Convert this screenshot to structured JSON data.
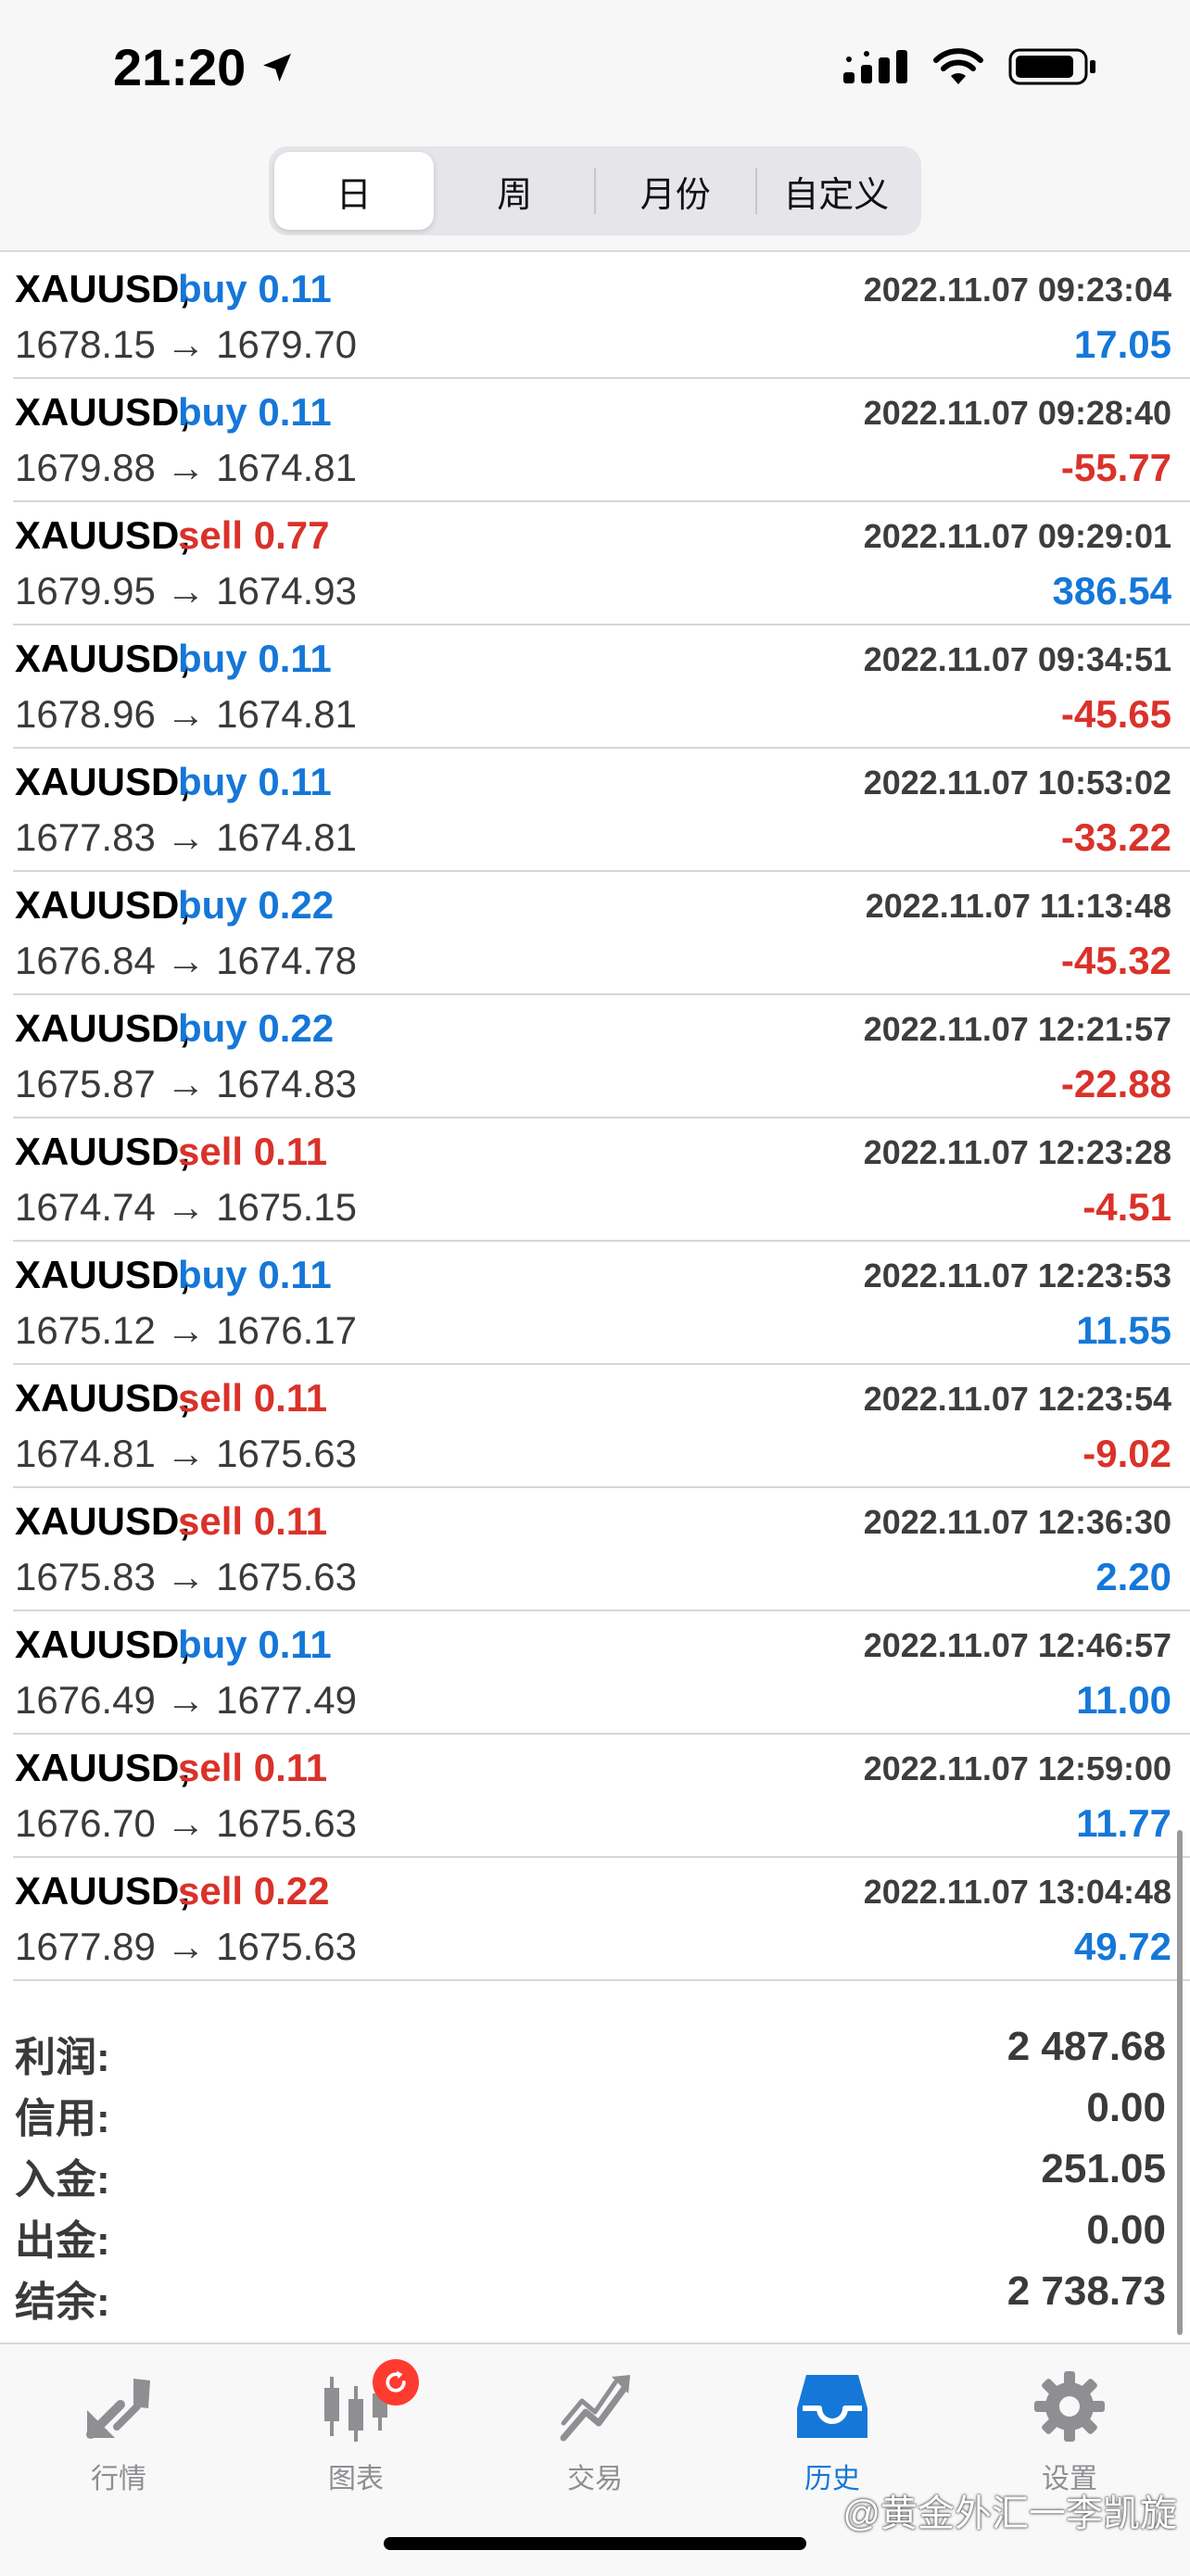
{
  "status_bar": {
    "time": "21:20"
  },
  "period_tabs": [
    {
      "label": "日",
      "active": true
    },
    {
      "label": "周",
      "active": false
    },
    {
      "label": "月份",
      "active": false
    },
    {
      "label": "自定义",
      "active": false
    }
  ],
  "deals": [
    {
      "symbol": "XAUUSD,",
      "type": "buy 0.11",
      "side": "buy",
      "prices": "1678.15 → 1679.70",
      "time": "2022.11.07 09:23:04",
      "profit": "17.05",
      "profit_sign": "pos"
    },
    {
      "symbol": "XAUUSD,",
      "type": "buy 0.11",
      "side": "buy",
      "prices": "1679.88 → 1674.81",
      "time": "2022.11.07 09:28:40",
      "profit": "-55.77",
      "profit_sign": "neg"
    },
    {
      "symbol": "XAUUSD,",
      "type": "sell 0.77",
      "side": "sell",
      "prices": "1679.95 → 1674.93",
      "time": "2022.11.07 09:29:01",
      "profit": "386.54",
      "profit_sign": "pos"
    },
    {
      "symbol": "XAUUSD,",
      "type": "buy 0.11",
      "side": "buy",
      "prices": "1678.96 → 1674.81",
      "time": "2022.11.07 09:34:51",
      "profit": "-45.65",
      "profit_sign": "neg"
    },
    {
      "symbol": "XAUUSD,",
      "type": "buy 0.11",
      "side": "buy",
      "prices": "1677.83 → 1674.81",
      "time": "2022.11.07 10:53:02",
      "profit": "-33.22",
      "profit_sign": "neg"
    },
    {
      "symbol": "XAUUSD,",
      "type": "buy 0.22",
      "side": "buy",
      "prices": "1676.84 → 1674.78",
      "time": "2022.11.07 11:13:48",
      "profit": "-45.32",
      "profit_sign": "neg"
    },
    {
      "symbol": "XAUUSD,",
      "type": "buy 0.22",
      "side": "buy",
      "prices": "1675.87 → 1674.83",
      "time": "2022.11.07 12:21:57",
      "profit": "-22.88",
      "profit_sign": "neg"
    },
    {
      "symbol": "XAUUSD,",
      "type": "sell 0.11",
      "side": "sell",
      "prices": "1674.74 → 1675.15",
      "time": "2022.11.07 12:23:28",
      "profit": "-4.51",
      "profit_sign": "neg"
    },
    {
      "symbol": "XAUUSD,",
      "type": "buy 0.11",
      "side": "buy",
      "prices": "1675.12 → 1676.17",
      "time": "2022.11.07 12:23:53",
      "profit": "11.55",
      "profit_sign": "pos"
    },
    {
      "symbol": "XAUUSD,",
      "type": "sell 0.11",
      "side": "sell",
      "prices": "1674.81 → 1675.63",
      "time": "2022.11.07 12:23:54",
      "profit": "-9.02",
      "profit_sign": "neg"
    },
    {
      "symbol": "XAUUSD,",
      "type": "sell 0.11",
      "side": "sell",
      "prices": "1675.83 → 1675.63",
      "time": "2022.11.07 12:36:30",
      "profit": "2.20",
      "profit_sign": "pos"
    },
    {
      "symbol": "XAUUSD,",
      "type": "buy 0.11",
      "side": "buy",
      "prices": "1676.49 → 1677.49",
      "time": "2022.11.07 12:46:57",
      "profit": "11.00",
      "profit_sign": "pos"
    },
    {
      "symbol": "XAUUSD,",
      "type": "sell 0.11",
      "side": "sell",
      "prices": "1676.70 → 1675.63",
      "time": "2022.11.07 12:59:00",
      "profit": "11.77",
      "profit_sign": "pos"
    },
    {
      "symbol": "XAUUSD,",
      "type": "sell 0.22",
      "side": "sell",
      "prices": "1677.89 → 1675.63",
      "time": "2022.11.07 13:04:48",
      "profit": "49.72",
      "profit_sign": "pos"
    }
  ],
  "summary": [
    {
      "label": "利润:",
      "value": "2 487.68"
    },
    {
      "label": "信用:",
      "value": "0.00"
    },
    {
      "label": "入金:",
      "value": "251.05"
    },
    {
      "label": "出金:",
      "value": "0.00"
    },
    {
      "label": "结余:",
      "value": "2 738.73"
    }
  ],
  "tabbar": [
    {
      "label": "行情",
      "icon": "quotes-arrows-icon",
      "active": false
    },
    {
      "label": "图表",
      "icon": "candlestick-chart-icon",
      "active": false
    },
    {
      "label": "交易",
      "icon": "trade-chart-icon",
      "active": false
    },
    {
      "label": "历史",
      "icon": "history-inbox-icon",
      "active": true
    },
    {
      "label": "设置",
      "icon": "settings-gear-icon",
      "active": false
    }
  ],
  "watermark": "@黄金外汇一李凯旋",
  "colors": {
    "buy": "#1577d8",
    "sell": "#d9322a",
    "profit_positive": "#1577d8",
    "profit_negative": "#d9322a",
    "active_tab": "#1577d8",
    "inactive_tab": "#8e8e93"
  }
}
